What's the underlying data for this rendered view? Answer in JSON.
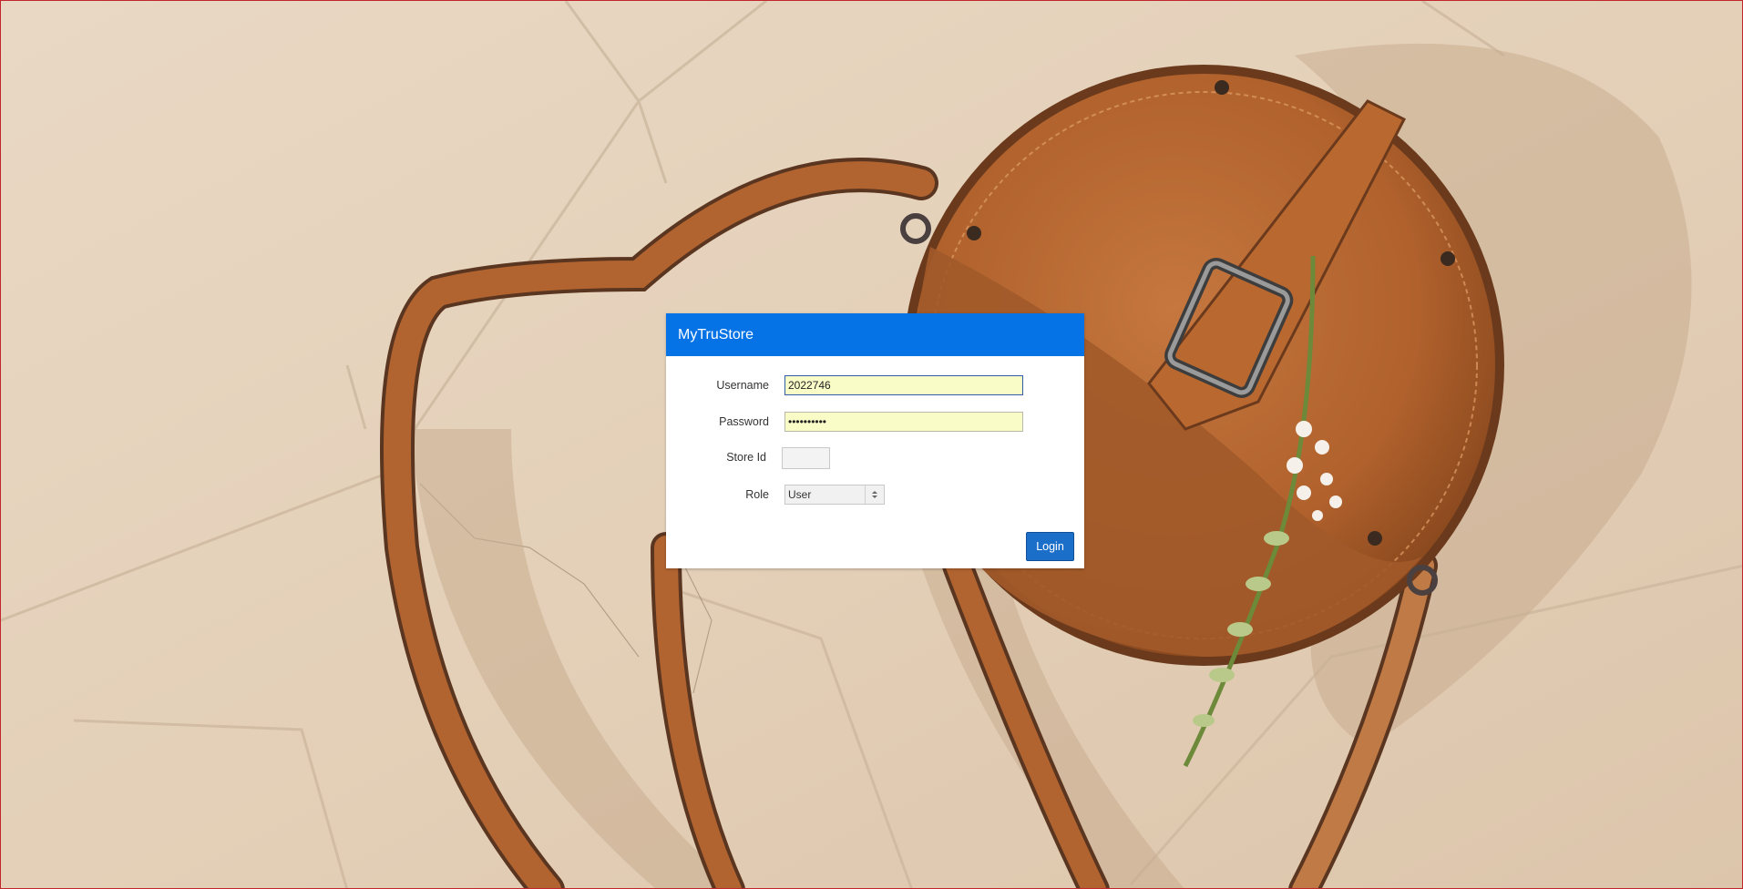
{
  "login": {
    "title": "MyTruStore",
    "username_label": "Username",
    "username_value": "2022746",
    "password_label": "Password",
    "password_value": "••••••••••",
    "store_id_label": "Store Id",
    "store_id_value": "",
    "role_label": "Role",
    "role_value": "User",
    "login_label": "Login"
  },
  "colors": {
    "header": "#0572e6",
    "button": "#1c6fc9",
    "autofill": "#fafcc8",
    "frame_border": "#c0262c"
  },
  "icons": [
    "select-arrow-icon"
  ]
}
